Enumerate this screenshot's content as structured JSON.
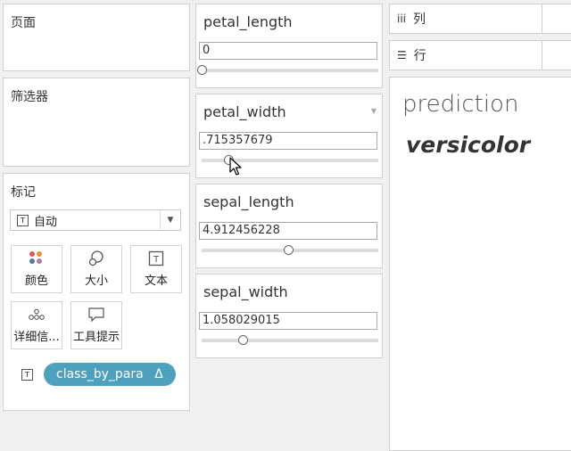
{
  "sidebar": {
    "pages_title": "页面",
    "filters_title": "筛选器",
    "marks_title": "标记",
    "mark_type": "自动",
    "mark_buttons": [
      {
        "label": "颜色",
        "icon": "color-dots-icon"
      },
      {
        "label": "大小",
        "icon": "size-icon"
      },
      {
        "label": "文本",
        "icon": "text-icon"
      },
      {
        "label": "详细信...",
        "icon": "detail-icon"
      },
      {
        "label": "工具提示",
        "icon": "tooltip-icon"
      }
    ],
    "pill": {
      "label": "class_by_para",
      "delta": "Δ",
      "color": "#4da1bf"
    }
  },
  "parameters": [
    {
      "name": "petal_length",
      "value": "0",
      "level": 0.0
    },
    {
      "name": "petal_width",
      "value": ".715357679",
      "level": 0.15
    },
    {
      "name": "sepal_length",
      "value": "4.912456228",
      "level": 0.49
    },
    {
      "name": "sepal_width",
      "value": "1.058029015",
      "level": 0.23
    }
  ],
  "shelves": {
    "columns": {
      "glyph": "iii",
      "label": "列"
    },
    "rows": {
      "glyph": "☰",
      "label": "行"
    }
  },
  "view": {
    "title": "prediction",
    "value": "versicolor"
  }
}
